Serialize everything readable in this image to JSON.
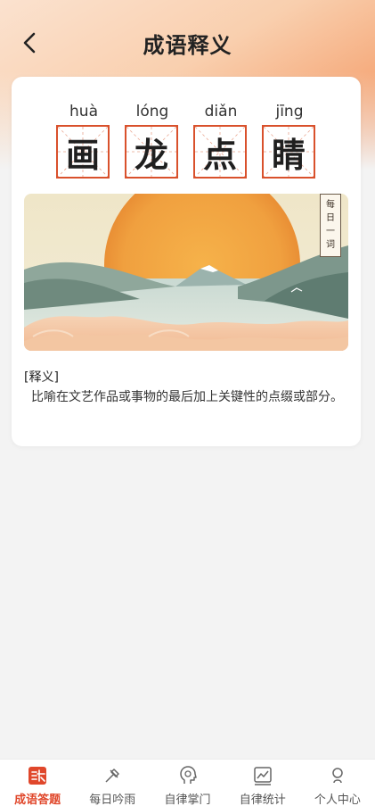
{
  "header": {
    "title": "成语释义"
  },
  "idiom": {
    "chars": [
      {
        "pinyin": "huà",
        "hanzi": "画"
      },
      {
        "pinyin": "lóng",
        "hanzi": "龙"
      },
      {
        "pinyin": "diǎn",
        "hanzi": "点"
      },
      {
        "pinyin": "jīng",
        "hanzi": "睛"
      }
    ],
    "badge": [
      "每",
      "日",
      "一",
      "词"
    ]
  },
  "definition": {
    "label": "[释义]",
    "text": "比喻在文艺作品或事物的最后加上关键性的点缀或部分。"
  },
  "tabbar": {
    "items": [
      {
        "label": "成语答题",
        "icon": "idiom-quiz-icon",
        "active": true
      },
      {
        "label": "每日吟雨",
        "icon": "pen-icon",
        "active": false
      },
      {
        "label": "自律掌门",
        "icon": "head-icon",
        "active": false
      },
      {
        "label": "自律统计",
        "icon": "chart-icon",
        "active": false
      },
      {
        "label": "个人中心",
        "icon": "person-icon",
        "active": false
      }
    ]
  },
  "colors": {
    "accent": "#d9512c",
    "active_tab": "#e0472b"
  }
}
